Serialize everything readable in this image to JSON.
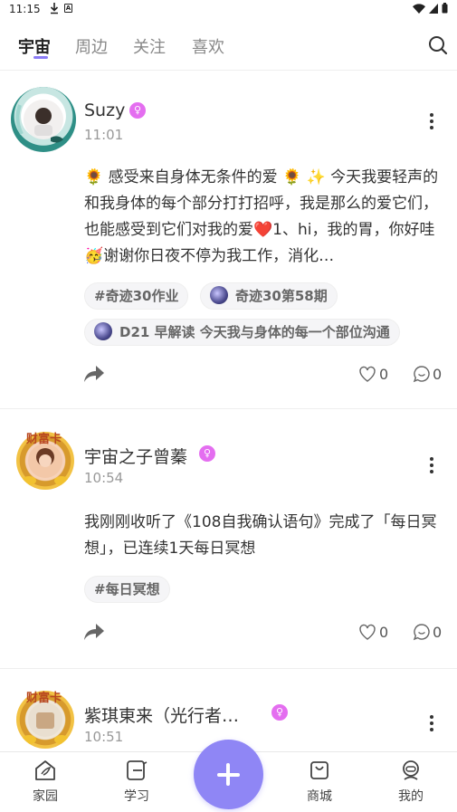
{
  "status_bar": {
    "time": "11:15"
  },
  "tabs": [
    {
      "label": "宇宙",
      "active": true
    },
    {
      "label": "周边",
      "active": false
    },
    {
      "label": "关注",
      "active": false
    },
    {
      "label": "喜欢",
      "active": false
    }
  ],
  "posts": [
    {
      "username": "Suzy",
      "gender": "♀",
      "time": "11:01",
      "content": "🌻 感受来自身体无条件的爱 🌻 ✨ 今天我要轻声的和我身体的每个部分打打招呼，我是那么的爱它们，也能感受到它们对我的爱❤️1、hi，我的胃，你好哇🥳谢谢你日夜不停为我工作，消化…",
      "tags": [
        "#奇迹30作业",
        "奇迹30第58期",
        "D21 早解读 今天我与身体的每一个部位沟通"
      ],
      "likes": "0",
      "comments": "0"
    },
    {
      "username": "宇宙之子曾蓁",
      "gender": "♀",
      "time": "10:54",
      "frame_label": "财富卡",
      "content": "我刚刚收听了《108自我确认语句》完成了「每日冥想」，已连续1天每日冥想",
      "tags": [
        "#每日冥想"
      ],
      "likes": "0",
      "comments": "0"
    },
    {
      "username": "紫琪東来（光行者…",
      "gender": "♀",
      "time": "10:51",
      "frame_label": "财富卡"
    }
  ],
  "bottom_nav": [
    {
      "label": "家园",
      "icon": "home-icon"
    },
    {
      "label": "学习",
      "icon": "study-icon"
    },
    {
      "label": "商城",
      "icon": "shop-icon"
    },
    {
      "label": "我的",
      "icon": "profile-icon"
    }
  ],
  "colors": {
    "accent": "#8f86f5",
    "gender_badge": "#e46ef0"
  }
}
